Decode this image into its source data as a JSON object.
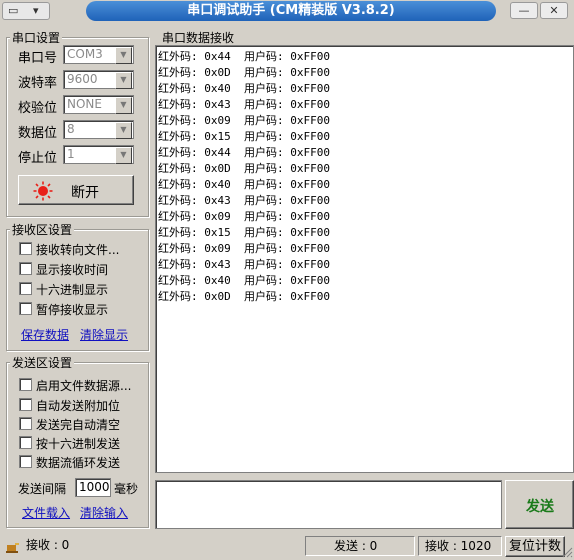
{
  "window": {
    "title": "串口调试助手 (CM精装版 V3.8.2)",
    "sysmenu_glyphs": [
      "▭",
      "▾"
    ],
    "min": "—",
    "close": "✕"
  },
  "serial": {
    "legend": "串口设置",
    "fields": [
      {
        "label": "串口号",
        "value": "COM3"
      },
      {
        "label": "波特率",
        "value": "9600"
      },
      {
        "label": "校验位",
        "value": "NONE"
      },
      {
        "label": "数据位",
        "value": "8"
      },
      {
        "label": "停止位",
        "value": "1"
      }
    ],
    "disconnect_label": "断开",
    "indicator_color": "#e8201a"
  },
  "recv_settings": {
    "legend": "接收区设置",
    "options": [
      "接收转向文件...",
      "显示接收时间",
      "十六进制显示",
      "暂停接收显示"
    ],
    "save_link": "保存数据",
    "clear_link": "清除显示"
  },
  "send_settings": {
    "legend": "发送区设置",
    "options": [
      "启用文件数据源...",
      "自动发送附加位",
      "发送完自动清空",
      "按十六进制发送",
      "数据流循环发送"
    ],
    "interval_label": "发送间隔",
    "interval_value": "1000",
    "interval_unit": "毫秒",
    "load_link": "文件载入",
    "clear_link": "清除输入"
  },
  "recv_area": {
    "legend": "串口数据接收",
    "lines": [
      {
        "ir": "红外码: 0x44",
        "user": "用户码: 0xFF00"
      },
      {
        "ir": "红外码: 0x0D",
        "user": "用户码: 0xFF00"
      },
      {
        "ir": "红外码: 0x40",
        "user": "用户码: 0xFF00"
      },
      {
        "ir": "红外码: 0x43",
        "user": "用户码: 0xFF00"
      },
      {
        "ir": "红外码: 0x09",
        "user": "用户码: 0xFF00"
      },
      {
        "ir": "红外码: 0x15",
        "user": "用户码: 0xFF00"
      },
      {
        "ir": "红外码: 0x44",
        "user": "用户码: 0xFF00"
      },
      {
        "ir": "红外码: 0x0D",
        "user": "用户码: 0xFF00"
      },
      {
        "ir": "红外码: 0x40",
        "user": "用户码: 0xFF00"
      },
      {
        "ir": "红外码: 0x43",
        "user": "用户码: 0xFF00"
      },
      {
        "ir": "红外码: 0x09",
        "user": "用户码: 0xFF00"
      },
      {
        "ir": "红外码: 0x15",
        "user": "用户码: 0xFF00"
      },
      {
        "ir": "红外码: 0x09",
        "user": "用户码: 0xFF00"
      },
      {
        "ir": "红外码: 0x43",
        "user": "用户码: 0xFF00"
      },
      {
        "ir": "红外码: 0x40",
        "user": "用户码: 0xFF00"
      },
      {
        "ir": "红外码: 0x0D",
        "user": "用户码: 0xFF00"
      }
    ]
  },
  "send_area": {
    "value": "",
    "send_label": "发送",
    "send_color": "#1a7a1a"
  },
  "status": {
    "recv_left": "接收 : 0",
    "sent": "发送 : 0",
    "received": "接收 : 1020",
    "reset_label": "复位计数"
  }
}
